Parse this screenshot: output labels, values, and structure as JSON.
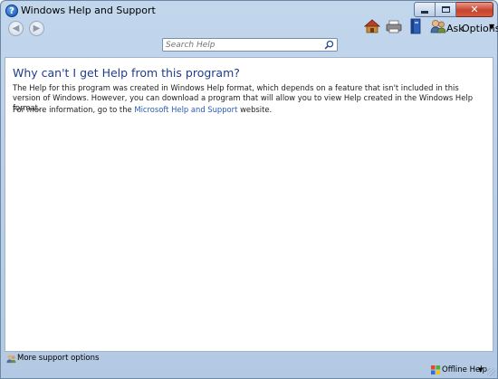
{
  "window": {
    "title": "Windows Help and Support",
    "help_glyph": "?"
  },
  "caption": {
    "close_glyph": "✕"
  },
  "toolbar": {
    "back_glyph": "◀",
    "forward_glyph": "▶",
    "ask_label": "Ask",
    "options_label": "Options",
    "options_arrow": "▼",
    "icons": [
      "home-icon",
      "print-icon",
      "browse-help-icon",
      "ask-icon"
    ]
  },
  "search": {
    "placeholder": "Search Help",
    "value": ""
  },
  "content": {
    "heading": "Why can't I get Help from this program?",
    "paragraph1": "The Help for this program was created in Windows Help format, which depends on a feature that isn't included in this version of Windows. However, you can download a program that will allow you to view Help created in the Windows Help format.",
    "paragraph2_prefix": "For more information, go to the ",
    "paragraph2_link": "Microsoft Help and Support",
    "paragraph2_suffix": " website."
  },
  "bottombar": {
    "support_label": "More support options",
    "offline_label": "Offline Help",
    "offline_arrow": "▼"
  },
  "colors": {
    "heading": "#1f3d8c",
    "link": "#2a5bb8",
    "frame": "#b3c9e3",
    "close_button": "#c7432c"
  }
}
